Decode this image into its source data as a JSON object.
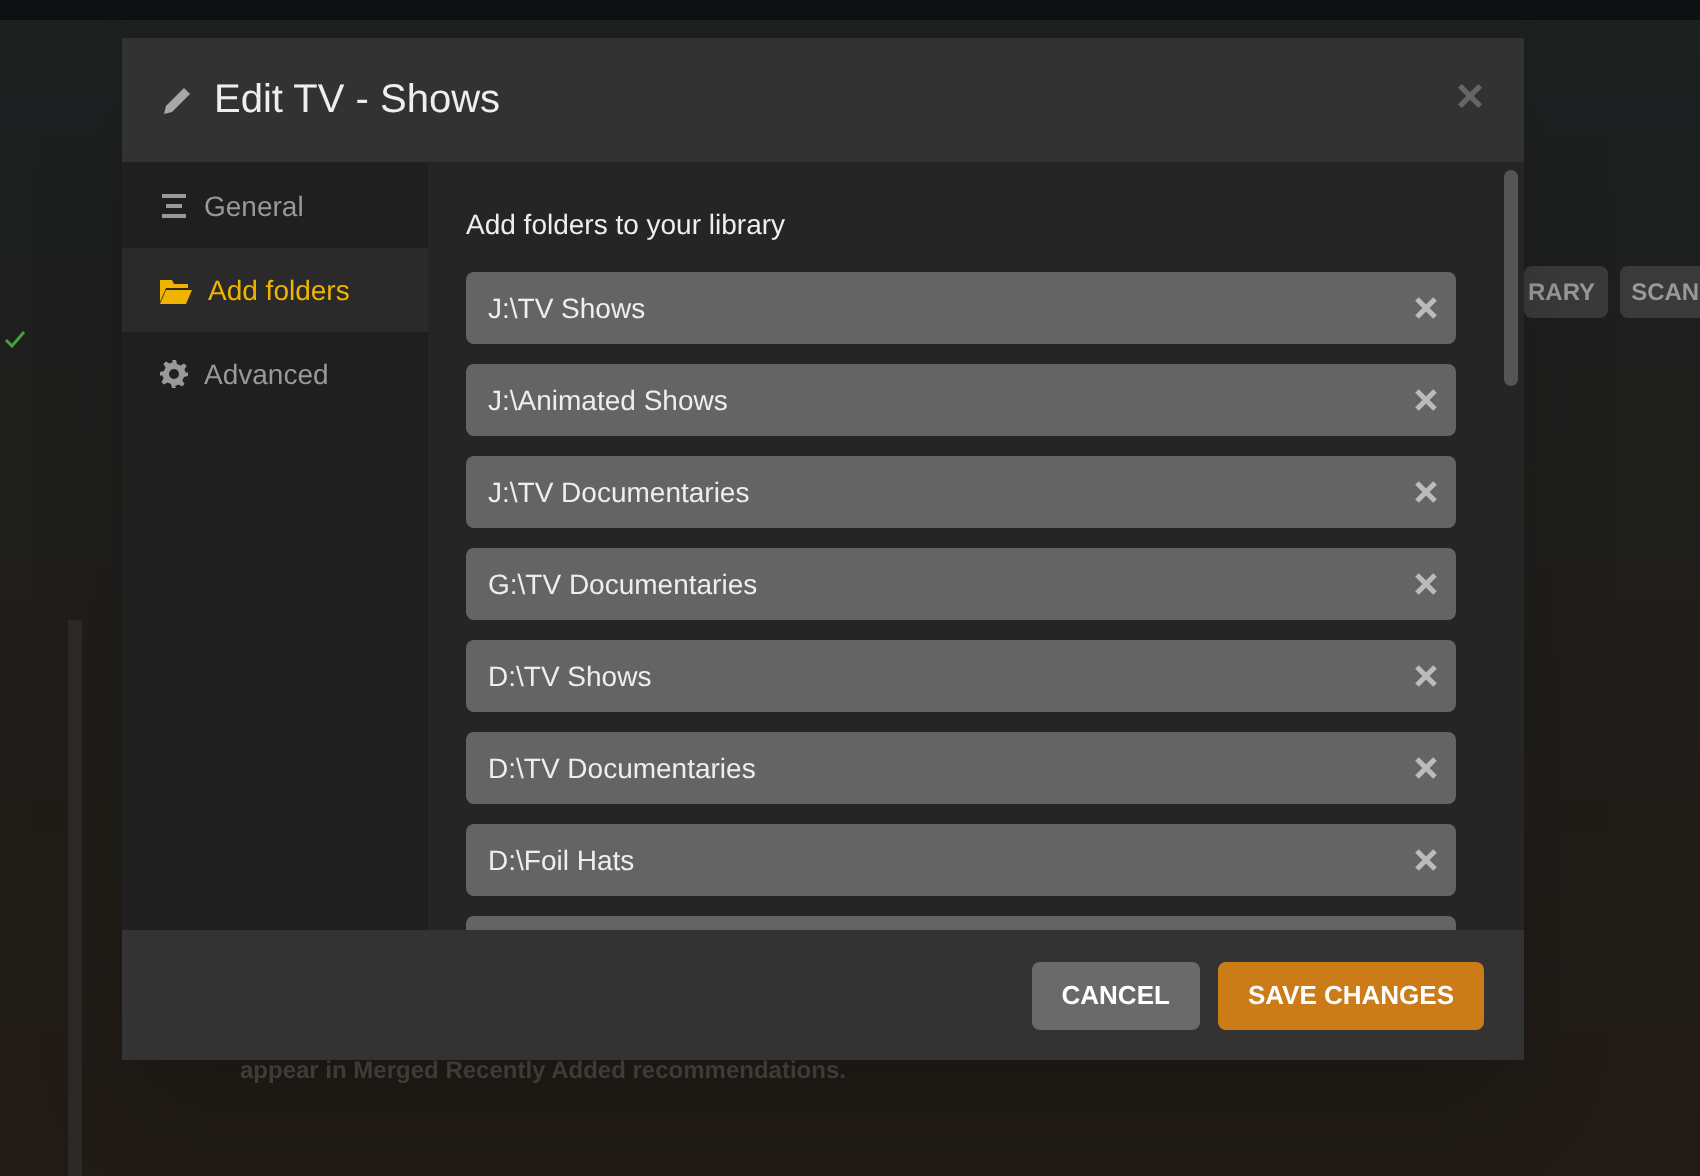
{
  "background": {
    "buttons": [
      "RARY",
      "SCAN"
    ],
    "note": "appear in Merged Recently Added recommendations."
  },
  "dialog": {
    "title": "Edit TV - Shows",
    "close": "×",
    "sidebar": [
      {
        "label": "General",
        "kind": "general",
        "selected": false
      },
      {
        "label": "Add folders",
        "kind": "folders",
        "selected": true
      },
      {
        "label": "Advanced",
        "kind": "advanced",
        "selected": false
      }
    ],
    "heading": "Add folders to your library",
    "folders": [
      {
        "path": "J:\\TV Shows"
      },
      {
        "path": "J:\\Animated Shows"
      },
      {
        "path": "J:\\TV Documentaries"
      },
      {
        "path": "G:\\TV Documentaries"
      },
      {
        "path": "D:\\TV Shows"
      },
      {
        "path": "D:\\TV Documentaries"
      },
      {
        "path": "D:\\Foil Hats"
      }
    ],
    "buttons": [
      {
        "label": "CANCEL",
        "kind": "secondary"
      },
      {
        "label": "SAVE CHANGES",
        "kind": "primary"
      }
    ]
  }
}
